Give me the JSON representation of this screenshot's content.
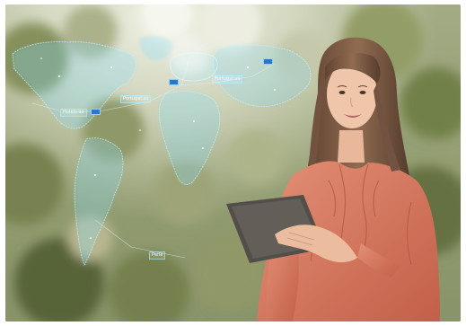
{
  "photo": {
    "subject": "woman holding tablet in front of holographic world map",
    "overlay_tags": [
      {
        "text": "Hotels ao"
      },
      {
        "text": "Portugal ao"
      },
      {
        "text": "Portugal ao"
      },
      {
        "text": "Perle"
      }
    ],
    "colors": {
      "hologram": "#8fe3ff",
      "blouse": "#d9735b",
      "hair": "#6b4a37",
      "skin": "#f0c3a6",
      "foliage": "#86905a",
      "tablet": "#4a4540"
    }
  }
}
